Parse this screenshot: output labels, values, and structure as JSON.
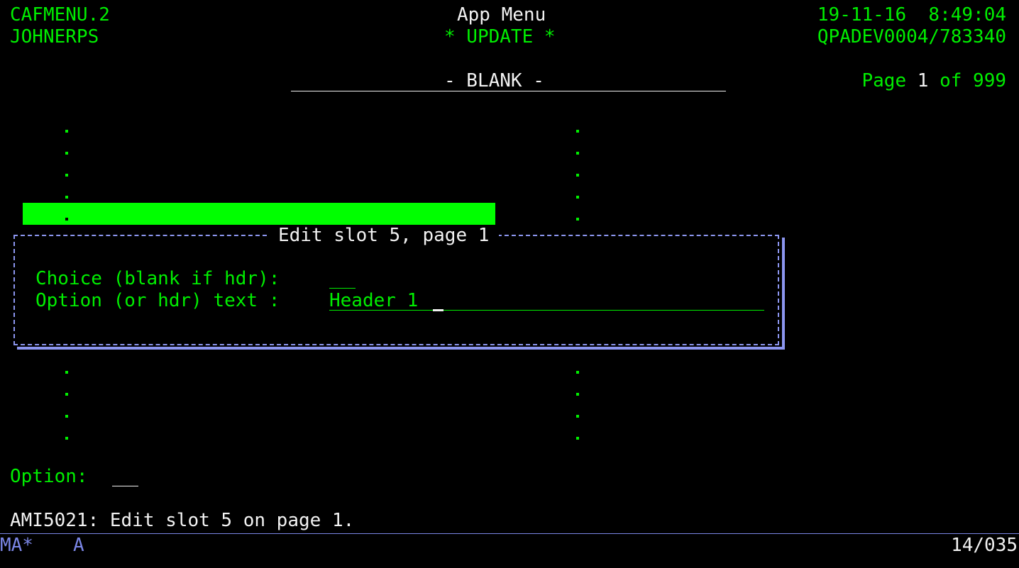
{
  "header": {
    "program": "CAFMENU.2",
    "user": "JOHNERPS",
    "title": "App Menu",
    "mode": "* UPDATE *",
    "datetime": "19-11-16  8:49:04",
    "job": "QPADEV0004/783340",
    "page_prefix": "Page",
    "page_current": "1",
    "page_of": "of 999",
    "section": "- BLANK -"
  },
  "popup": {
    "title": "Edit slot 5, page 1",
    "choice_label": "Choice (blank if hdr):",
    "choice_value": "",
    "text_label": "Option (or hdr) text :",
    "text_value": "Header 1"
  },
  "option": {
    "label": "Option:",
    "value": ""
  },
  "message": "AMI5021: Edit slot 5 on page 1.",
  "status_bar": {
    "left": "MA*",
    "mode": "A",
    "position": "14/035"
  },
  "colors": {
    "text_green": "#00ee00",
    "text_white": "#f2f2f2",
    "highlight_green": "#00ff00",
    "popup_border": "#8c96f0",
    "status_blue": "#7b86e6",
    "background": "#000000"
  }
}
